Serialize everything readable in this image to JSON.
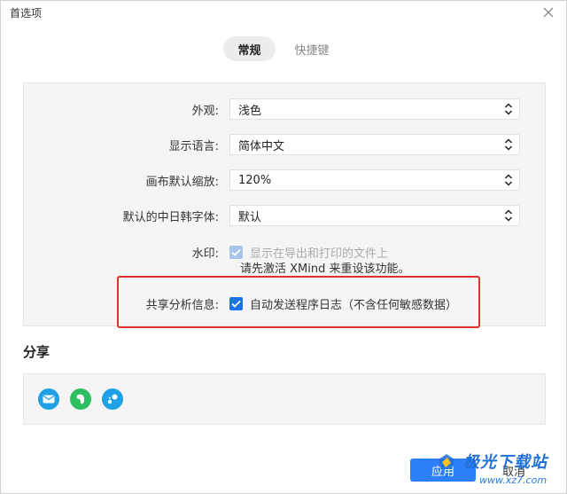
{
  "window": {
    "title": "首选项"
  },
  "tabs": [
    {
      "label": "常规",
      "active": true
    },
    {
      "label": "快捷键",
      "active": false
    }
  ],
  "general": {
    "appearance": {
      "label": "外观:",
      "value": "浅色"
    },
    "language": {
      "label": "显示语言:",
      "value": "简体中文"
    },
    "zoom": {
      "label": "画布默认缩放:",
      "value": "120%"
    },
    "cjk_font": {
      "label": "默认的中日韩字体:",
      "value": "默认"
    },
    "watermark": {
      "label": "水印:",
      "option": "显示在导出和打印的文件上",
      "checked": true,
      "disabled": true,
      "note": "请先激活 XMind 来重设该功能。"
    },
    "analytics": {
      "label": "共享分析信息:",
      "option": "自动发送程序日志（不含任何敏感数据）",
      "checked": true
    }
  },
  "share": {
    "title": "分享",
    "icons": [
      {
        "name": "mail-icon",
        "color": "#1fa0e6"
      },
      {
        "name": "evernote-icon",
        "color": "#2dbe60"
      },
      {
        "name": "share-link-icon",
        "color": "#1fa0e6"
      }
    ]
  },
  "footer": {
    "apply_label": "应用",
    "cancel_label": "取消"
  },
  "site_watermark": {
    "text": "极光下载站",
    "url": "www.xz7.com"
  },
  "colors": {
    "accent": "#2d7ff9",
    "highlight": "#e0312b"
  }
}
